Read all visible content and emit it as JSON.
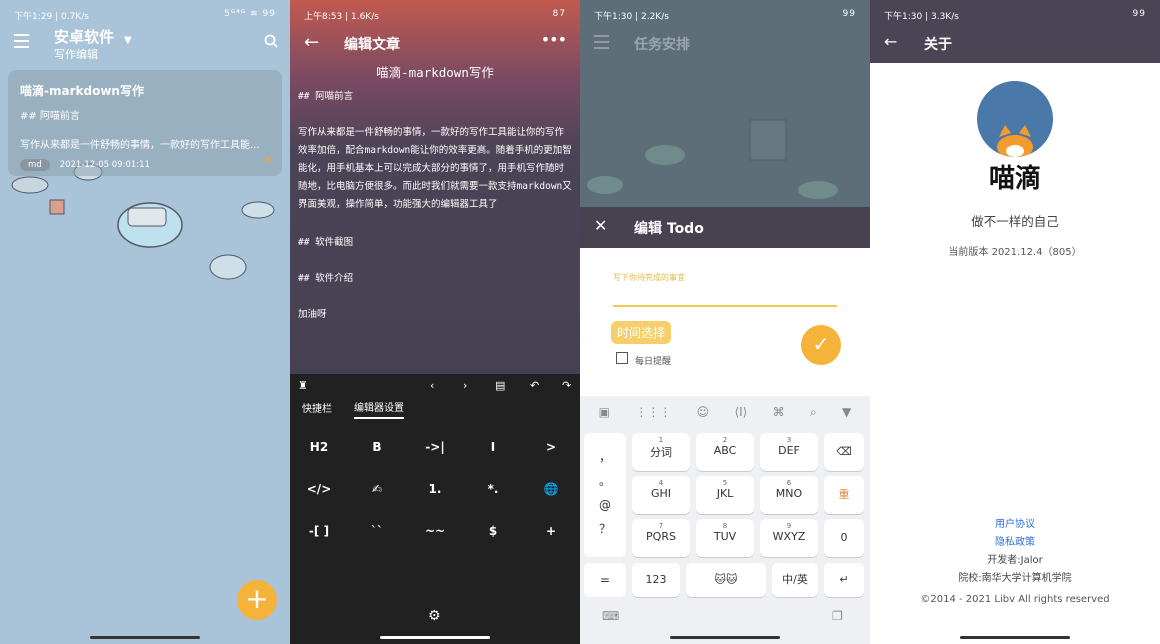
{
  "screen1": {
    "status": {
      "time": "下午1:29",
      "speed": "0.7K/s",
      "right": "5ᴳ⁴ᴳ ≋ 99"
    },
    "title": "安卓软件",
    "subtitle": "写作编辑",
    "card": {
      "title": "喵滴-markdown写作",
      "heading": "## 阿喵前言",
      "preview": "写作从来都是一件舒畅的事情，一款好的写作工具能...",
      "tag": "md",
      "date": "2021-12-05 09:01:11"
    },
    "fab": "+"
  },
  "screen2": {
    "status": {
      "time": "上午8:53",
      "speed": "1.6K/s",
      "right": "87"
    },
    "title": "编辑文章",
    "doc_title": "喵滴-markdown写作",
    "lines": [
      "## 阿喵前言",
      "写作从来都是一件舒畅的事情，一款好的写作工具能让你的写作效率加倍，配合markdown能让你的效率更高。随着手机的更加智能化，用手机基本上可以完成大部分的事情了，用手机写作随时随地，比电脑方便很多。而此时我们就需要一款支持markdown又界面美观，操作简单，功能强大的编辑器工具了",
      "## 软件截图",
      "## 软件介绍",
      "加油呀"
    ],
    "tabs": [
      "快捷栏",
      "编辑器设置"
    ],
    "keys": [
      "H2",
      "B",
      "->|",
      "I",
      ">",
      "</>",
      "✍",
      "1.",
      "*.",
      "🌐",
      "-[ ]",
      "``",
      "~~",
      "$",
      "+"
    ]
  },
  "screen3": {
    "status": {
      "time": "下午1:30",
      "speed": "2.2K/s",
      "right": "99"
    },
    "title": "任务安排",
    "edit_title": "编辑 Todo",
    "placeholder": "写下你待完成的事宜",
    "time_btn": "时间选择",
    "daily": "每日提醒",
    "ime_symbols": [
      "，",
      "。",
      "@",
      "？",
      "="
    ],
    "ime_rows": [
      [
        {
          "n": "1",
          "l": "分词"
        },
        {
          "n": "2",
          "l": "ABC"
        },
        {
          "n": "3",
          "l": "DEF"
        }
      ],
      [
        {
          "n": "4",
          "l": "GHI"
        },
        {
          "n": "5",
          "l": "JKL"
        },
        {
          "n": "6",
          "l": "MNO"
        }
      ],
      [
        {
          "n": "7",
          "l": "PQRS"
        },
        {
          "n": "8",
          "l": "TUV"
        },
        {
          "n": "9",
          "l": "WXYZ"
        }
      ]
    ],
    "ime_side": [
      "⌫",
      "重",
      "0"
    ],
    "ime_bottom": [
      "123",
      "中/英",
      "↵"
    ]
  },
  "screen4": {
    "status": {
      "time": "下午1:30",
      "speed": "3.3K/s",
      "right": "99"
    },
    "title": "关于",
    "app_name": "喵滴",
    "slogan": "做不一样的自己",
    "version": "当前版本 2021.12.4（805）",
    "link1": "用户协议",
    "link2": "隐私政策",
    "developer": "开发者:Jalor",
    "school": "院校:南华大学计算机学院",
    "copyright": "©2014 - 2021 Libv All rights reserved"
  },
  "colors": {
    "accent": "#f6b33a",
    "dark_bar": "#474150",
    "link": "#2f6fd6"
  }
}
